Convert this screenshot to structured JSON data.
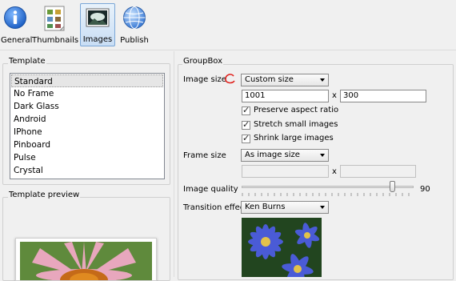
{
  "toolbar": {
    "buttons": [
      {
        "label": "General",
        "icon": "info-icon"
      },
      {
        "label": "Thumbnails",
        "icon": "thumbnails-icon"
      },
      {
        "label": "Images",
        "icon": "image-icon"
      },
      {
        "label": "Publish",
        "icon": "globe-icon"
      }
    ],
    "selected": "Images"
  },
  "template": {
    "group_title": "Template",
    "items": [
      "Standard",
      "No Frame",
      "Dark Glass",
      "Android",
      "IPhone",
      "Pinboard",
      "Pulse",
      "Crystal"
    ],
    "selected": "Standard"
  },
  "preview": {
    "group_title": "Template preview"
  },
  "groupbox": {
    "title": "GroupBox",
    "image_size": {
      "label": "Image size",
      "value": "Custom size",
      "width": "1001",
      "times": "x",
      "height": "300",
      "options": {
        "preserve": "Preserve aspect ratio",
        "stretch": "Stretch small images",
        "shrink": "Shrink large images"
      }
    },
    "frame_size": {
      "label": "Frame size",
      "value": "As image size",
      "width": "",
      "times": "x",
      "height": ""
    },
    "image_quality": {
      "label": "Image quality",
      "value": "90",
      "level": 90
    },
    "transition": {
      "label": "Transition effect",
      "value": "Ken Burns"
    }
  },
  "colors": {
    "accent": "#3a7ad5",
    "selection": "#e6e6e6",
    "annotation": "#e0201c"
  }
}
